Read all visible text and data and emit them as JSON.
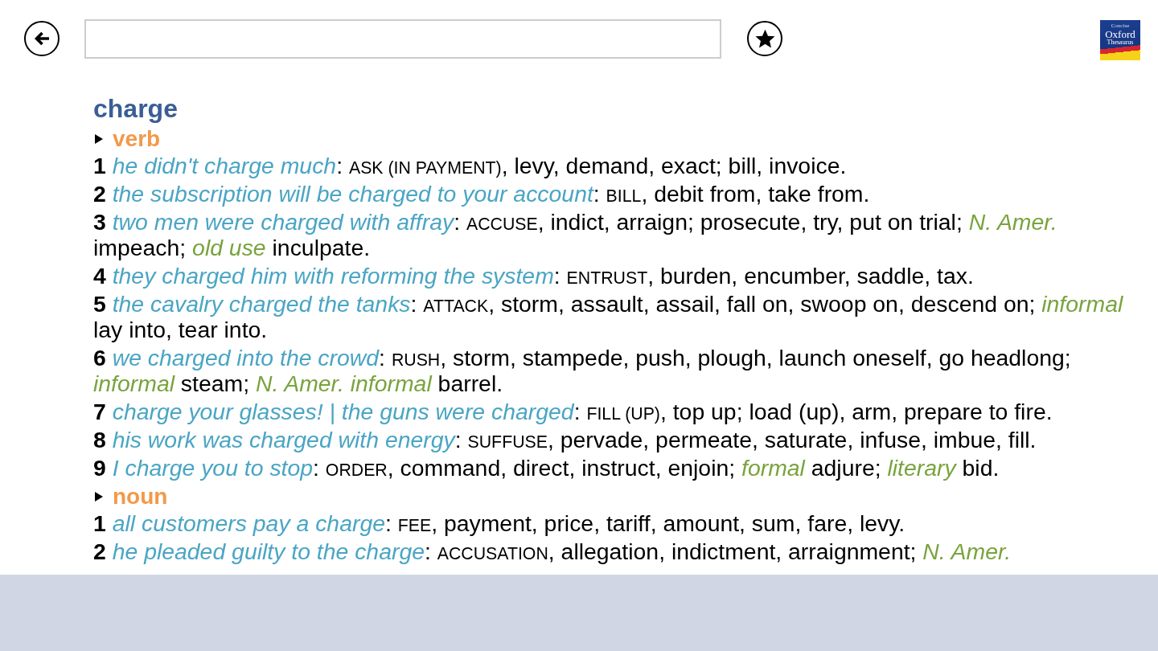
{
  "logo": {
    "lines": [
      "Concise",
      "Oxford",
      "Thesaurus"
    ]
  },
  "entry": {
    "headword": "charge",
    "sections": [
      {
        "part_of_speech": "verb",
        "senses": [
          {
            "number": "1",
            "segments": [
              {
                "kind": "example",
                "text": "he didn't charge much"
              },
              {
                "kind": "plain",
                "text": ": "
              },
              {
                "kind": "core",
                "text": "ASK (IN PAYMENT)"
              },
              {
                "kind": "plain",
                "text": ", levy, demand, exact; bill, invoice."
              }
            ]
          },
          {
            "number": "2",
            "segments": [
              {
                "kind": "example",
                "text": "the subscription will be charged to your account"
              },
              {
                "kind": "plain",
                "text": ": "
              },
              {
                "kind": "core",
                "text": "BILL"
              },
              {
                "kind": "plain",
                "text": ", debit from, take from."
              }
            ]
          },
          {
            "number": "3",
            "segments": [
              {
                "kind": "example",
                "text": "two men were charged with affray"
              },
              {
                "kind": "plain",
                "text": ": "
              },
              {
                "kind": "core",
                "text": "ACCUSE"
              },
              {
                "kind": "plain",
                "text": ", indict, arraign; prosecute, try, put on trial; "
              },
              {
                "kind": "label",
                "text": "N. Amer."
              },
              {
                "kind": "plain",
                "text": " impeach; "
              },
              {
                "kind": "label",
                "text": "old use"
              },
              {
                "kind": "plain",
                "text": " inculpate."
              }
            ]
          },
          {
            "number": "4",
            "segments": [
              {
                "kind": "example",
                "text": "they charged him with reforming the system"
              },
              {
                "kind": "plain",
                "text": ": "
              },
              {
                "kind": "core",
                "text": "ENTRUST"
              },
              {
                "kind": "plain",
                "text": ", burden, encumber, saddle, tax."
              }
            ]
          },
          {
            "number": "5",
            "segments": [
              {
                "kind": "example",
                "text": "the cavalry charged the tanks"
              },
              {
                "kind": "plain",
                "text": ": "
              },
              {
                "kind": "core",
                "text": "ATTACK"
              },
              {
                "kind": "plain",
                "text": ", storm, assault, assail, fall on, swoop on, descend on; "
              },
              {
                "kind": "label",
                "text": "informal"
              },
              {
                "kind": "plain",
                "text": " lay into, tear into."
              }
            ]
          },
          {
            "number": "6",
            "segments": [
              {
                "kind": "example",
                "text": "we charged into the crowd"
              },
              {
                "kind": "plain",
                "text": ": "
              },
              {
                "kind": "core",
                "text": "RUSH"
              },
              {
                "kind": "plain",
                "text": ", storm, stampede, push, plough, launch oneself, go headlong; "
              },
              {
                "kind": "label",
                "text": "informal"
              },
              {
                "kind": "plain",
                "text": " steam; "
              },
              {
                "kind": "label",
                "text": "N. Amer. informal"
              },
              {
                "kind": "plain",
                "text": " barrel."
              }
            ]
          },
          {
            "number": "7",
            "segments": [
              {
                "kind": "example",
                "text": "charge your glasses! | the guns were charged"
              },
              {
                "kind": "plain",
                "text": ": "
              },
              {
                "kind": "core",
                "text": "FILL (UP)"
              },
              {
                "kind": "plain",
                "text": ", top up; load (up), arm, prepare to fire."
              }
            ]
          },
          {
            "number": "8",
            "segments": [
              {
                "kind": "example",
                "text": "his work was charged with energy"
              },
              {
                "kind": "plain",
                "text": ": "
              },
              {
                "kind": "core",
                "text": "SUFFUSE"
              },
              {
                "kind": "plain",
                "text": ", pervade, permeate, saturate, infuse, imbue, fill."
              }
            ]
          },
          {
            "number": "9",
            "segments": [
              {
                "kind": "example",
                "text": "I charge you to stop"
              },
              {
                "kind": "plain",
                "text": ": "
              },
              {
                "kind": "core",
                "text": "ORDER"
              },
              {
                "kind": "plain",
                "text": ", command, direct, instruct, enjoin; "
              },
              {
                "kind": "label",
                "text": "formal"
              },
              {
                "kind": "plain",
                "text": " adjure; "
              },
              {
                "kind": "label",
                "text": "literary"
              },
              {
                "kind": "plain",
                "text": " bid."
              }
            ]
          }
        ]
      },
      {
        "part_of_speech": "noun",
        "senses": [
          {
            "number": "1",
            "segments": [
              {
                "kind": "example",
                "text": "all customers pay a charge"
              },
              {
                "kind": "plain",
                "text": ": "
              },
              {
                "kind": "core",
                "text": "FEE"
              },
              {
                "kind": "plain",
                "text": ", payment, price, tariff, amount, sum, fare, levy."
              }
            ]
          },
          {
            "number": "2",
            "segments": [
              {
                "kind": "example",
                "text": "he pleaded guilty to the charge"
              },
              {
                "kind": "plain",
                "text": ": "
              },
              {
                "kind": "core",
                "text": "ACCUSATION"
              },
              {
                "kind": "plain",
                "text": ", allegation, indictment, arraignment; "
              },
              {
                "kind": "label",
                "text": "N. Amer."
              }
            ]
          }
        ]
      }
    ]
  }
}
